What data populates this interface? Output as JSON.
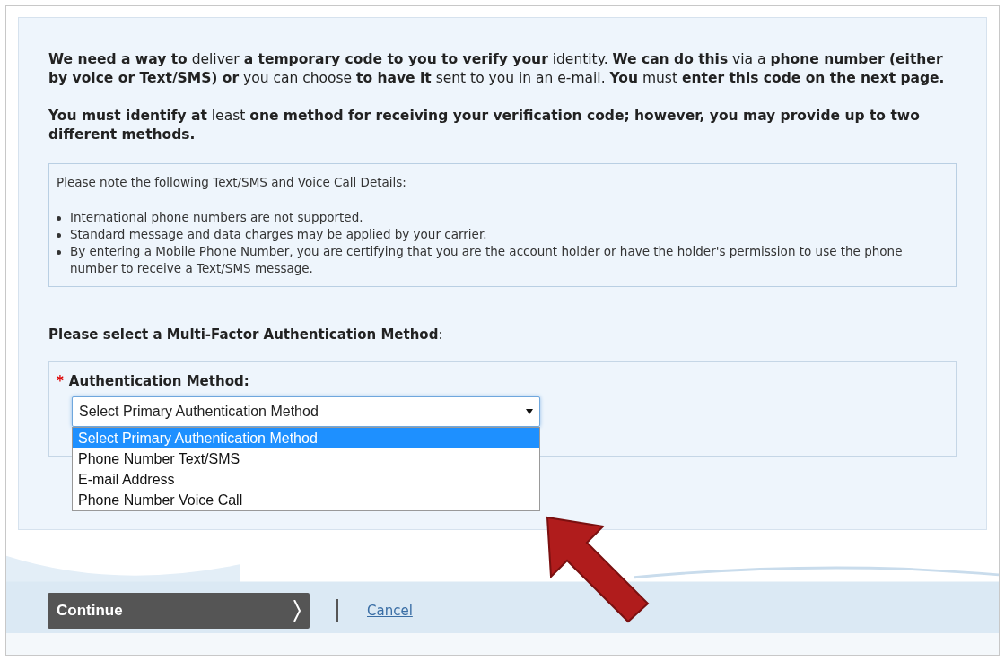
{
  "intro": [
    "**We need a way to** deliver **a temporary code to you to verify your** identity. **We can do this** via a **phone number (either by voice or Text/SMS) or** you can choose **to have it** sent to you in an e-mail. **You** must **enter this code on the next page.**",
    "**You must identify at** least **one method for receiving your verification code; however, you may provide up to two different methods.**"
  ],
  "notice": {
    "heading": "Please note the following Text/SMS and Voice Call Details:",
    "items": [
      "International phone numbers are not supported.",
      "Standard message and data charges may be applied by your carrier.",
      "By entering a Mobile Phone Number, you are certifying that you are the account holder or have the holder's permission to use the phone number to receive a Text/SMS message."
    ]
  },
  "mfa_prompt": "**Please select a Multi-Factor Authentication Method**:",
  "field": {
    "required_mark": "*",
    "label": "Authentication Method:",
    "value": "Select Primary Authentication Method",
    "expanded": true,
    "options": [
      {
        "label": "Select Primary Authentication Method",
        "selected": true
      },
      {
        "label": "Phone Number Text/SMS",
        "selected": false
      },
      {
        "label": "E-mail Address",
        "selected": false
      },
      {
        "label": "Phone Number Voice Call",
        "selected": false
      }
    ]
  },
  "actions": {
    "continue": "Continue",
    "cancel": "Cancel"
  }
}
